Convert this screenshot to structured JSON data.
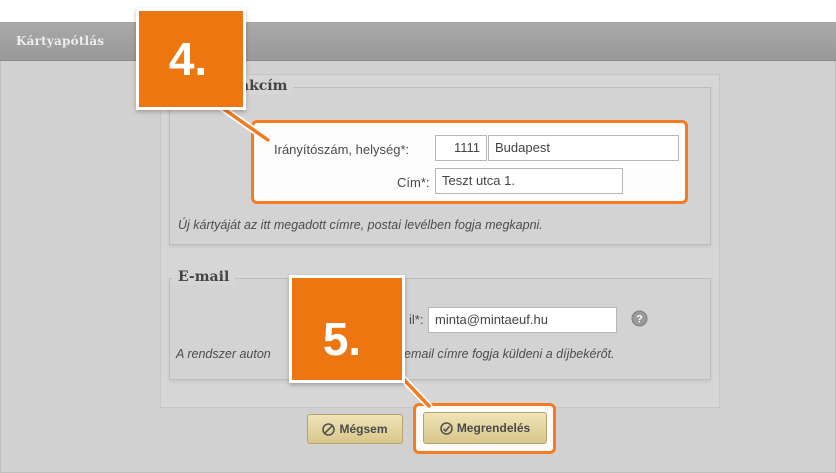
{
  "header": {
    "title": "Kártyapótlás"
  },
  "postal_section": {
    "legend_visible_part": "akcím",
    "zip_city_label": "Irányítószám, helység*:",
    "zip_value": "1111",
    "city_value": "Budapest",
    "address_label": "Cím*:",
    "address_value": "Teszt utca 1.",
    "note": "Új kártyáját az itt megadott címre, postai levélben fogja megkapni."
  },
  "email_section": {
    "legend": "E-mail",
    "email_label_visible_part": "il*:",
    "email_value": "minta@mintaeuf.hu",
    "note_left": "A rendszer auton",
    "note_right": "email címre fogja küldeni a díjbekérőt."
  },
  "buttons": {
    "cancel_label": "Mégsem",
    "submit_label": "Megrendelés"
  },
  "steps": {
    "step4": "4.",
    "step5": "5."
  },
  "colors": {
    "highlight": "#f47b20",
    "badge": "#ee7611",
    "button": "#e3d49f"
  }
}
